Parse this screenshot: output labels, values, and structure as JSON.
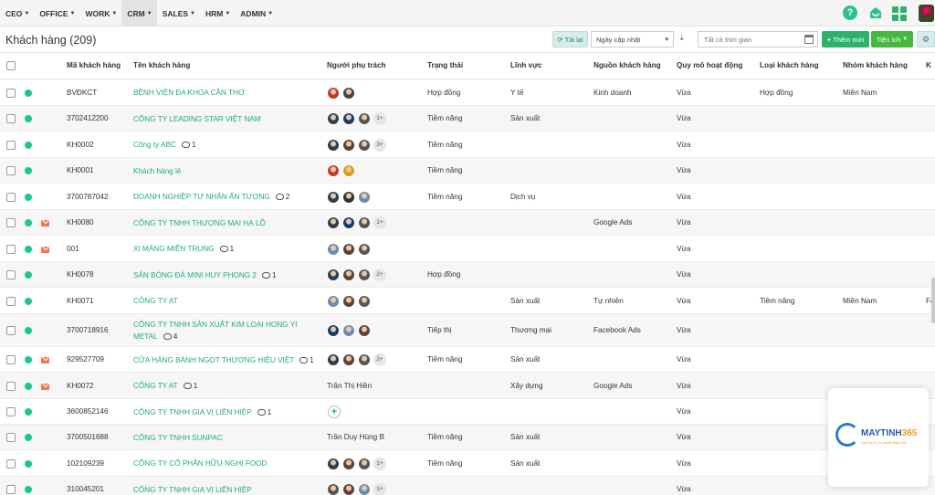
{
  "nav": {
    "menu": [
      {
        "label": "CEO",
        "active": false
      },
      {
        "label": "OFFICE",
        "active": false
      },
      {
        "label": "WORK",
        "active": false
      },
      {
        "label": "CRM",
        "active": true
      },
      {
        "label": "SALES",
        "active": false
      },
      {
        "label": "HRM",
        "active": false
      },
      {
        "label": "ADMIN",
        "active": false
      }
    ],
    "help_glyph": "?"
  },
  "toolbar": {
    "title": "Khách hàng (209)",
    "reload_label": "Tải lại",
    "sort_value": "Ngày cập nhật",
    "date_placeholder": "Tất cả thời gian",
    "add_label": "Thêm mới",
    "util_label": "Tiện ích"
  },
  "table": {
    "columns": [
      "Mã khách hàng",
      "Tên khách hàng",
      "Người phụ trách",
      "Trạng thái",
      "Lĩnh vực",
      "Nguồn khách hàng",
      "Quy mô hoạt động",
      "Loại khách hàng",
      "Nhóm khách hàng",
      "K"
    ],
    "rows": [
      {
        "code": "BVĐKCT",
        "name": "BỆNH VIỆN ĐA KHOA CẦN THƠ",
        "name2": "",
        "comments": "",
        "mail": false,
        "avatars": [
          "#c0392b",
          "#444"
        ],
        "more": "",
        "owner_text": "",
        "add": false,
        "status": "Hợp đồng",
        "field": "Y tế",
        "source": "Kinh doanh",
        "scale": "Vừa",
        "type": "Hợp đồng",
        "group": "Miền Nam",
        "extra": ""
      },
      {
        "code": "3702412200",
        "name": "CÔNG TY LEADING STAR VIỆT NAM",
        "name2": "",
        "comments": "",
        "mail": false,
        "avatars": [
          "#2c3e50",
          "#1a3a6b",
          "#555"
        ],
        "more": "1+",
        "owner_text": "",
        "add": false,
        "status": "Tiềm năng",
        "field": "Sản xuất",
        "source": "",
        "scale": "Vừa",
        "type": "",
        "group": "",
        "extra": ""
      },
      {
        "code": "KH0002",
        "name": "Công ty ABC",
        "name2": "",
        "comments": "1",
        "mail": false,
        "avatars": [
          "#2c3e50",
          "#5d4037",
          "#555"
        ],
        "more": "3+",
        "owner_text": "",
        "add": false,
        "status": "Tiềm năng",
        "field": "",
        "source": "",
        "scale": "Vừa",
        "type": "",
        "group": "",
        "extra": ""
      },
      {
        "code": "KH0001",
        "name": "Khách hàng lẻ",
        "name2": "",
        "comments": "",
        "mail": false,
        "avatars": [
          "#c0392b",
          "#d4a017"
        ],
        "more": "",
        "owner_text": "",
        "add": false,
        "status": "Tiềm năng",
        "field": "",
        "source": "",
        "scale": "Vừa",
        "type": "",
        "group": "",
        "extra": ""
      },
      {
        "code": "3700787042",
        "name": "DOANH NGHIỆP TƯ NHÂN ẤN TƯỢNG",
        "name2": "",
        "comments": "2",
        "mail": false,
        "avatars": [
          "#2c3e50",
          "#333",
          "#6d8ab0"
        ],
        "more": "",
        "owner_text": "",
        "add": false,
        "status": "Tiềm năng",
        "field": "Dịch vụ",
        "source": "",
        "scale": "Vừa",
        "type": "",
        "group": "",
        "extra": ""
      },
      {
        "code": "KH0080",
        "name": "CÔNG TY TNHH THƯƠNG MẠI HẠ LỘ",
        "name2": "",
        "comments": "",
        "mail": true,
        "avatars": [
          "#2c3e50",
          "#1a3a6b",
          "#555"
        ],
        "more": "1+",
        "owner_text": "",
        "add": false,
        "status": "",
        "field": "",
        "source": "Google Ads",
        "scale": "Vừa",
        "type": "",
        "group": "",
        "extra": ""
      },
      {
        "code": "001",
        "name": "XI MĂNG MIỀN TRUNG",
        "name2": "",
        "comments": "1",
        "mail": true,
        "avatars": [
          "#6d8ab0",
          "#5d4037",
          "#555"
        ],
        "more": "",
        "owner_text": "",
        "add": false,
        "status": "",
        "field": "",
        "source": "",
        "scale": "Vừa",
        "type": "",
        "group": "",
        "extra": ""
      },
      {
        "code": "KH0078",
        "name": "SÂN BÓNG ĐÁ MINI HUY PHONG 2",
        "name2": "",
        "comments": "1",
        "mail": false,
        "avatars": [
          "#2c3e50",
          "#5d4037",
          "#555"
        ],
        "more": "2+",
        "owner_text": "",
        "add": false,
        "status": "Hợp đồng",
        "field": "",
        "source": "",
        "scale": "Vừa",
        "type": "",
        "group": "",
        "extra": ""
      },
      {
        "code": "KH0071",
        "name": "CÔNG TY AT",
        "name2": "",
        "comments": "",
        "mail": false,
        "avatars": [
          "#6d8ab0",
          "#5d4037",
          "#555"
        ],
        "more": "",
        "owner_text": "",
        "add": false,
        "status": "",
        "field": "Sản xuất",
        "source": "Tự nhiên",
        "scale": "Vừa",
        "type": "Tiềm năng",
        "group": "Miền Nam",
        "extra": "Fa"
      },
      {
        "code": "3700718916",
        "name": "CÔNG TY TNHH SẢN XUẤT KIM LOẠI HONG YI",
        "name2": "METAL",
        "comments": "4",
        "mail": false,
        "avatars": [
          "#1a3a6b",
          "#6d8ab0",
          "#5d4037"
        ],
        "more": "",
        "owner_text": "",
        "add": false,
        "status": "Tiếp thị",
        "field": "Thương mại",
        "source": "Facebook Ads",
        "scale": "Vừa",
        "type": "",
        "group": "",
        "extra": ""
      },
      {
        "code": "929527709",
        "name": "CỬA HÀNG BÁNH NGỌT THƯƠNG HIỆU VIỆT",
        "name2": "",
        "comments": "1",
        "mail": true,
        "avatars": [
          "#2c3e50",
          "#5d4037",
          "#555"
        ],
        "more": "2+",
        "owner_text": "",
        "add": false,
        "status": "Tiềm năng",
        "field": "Sản xuất",
        "source": "",
        "scale": "Vừa",
        "type": "",
        "group": "",
        "extra": ""
      },
      {
        "code": "KH0072",
        "name": "CÔNG TY AT",
        "name2": "",
        "comments": "1",
        "mail": true,
        "avatars": [],
        "more": "",
        "owner_text": "Trần Thị Hiền",
        "add": false,
        "status": "",
        "field": "Xây dựng",
        "source": "Google Ads",
        "scale": "Vừa",
        "type": "",
        "group": "",
        "extra": ""
      },
      {
        "code": "3600852146",
        "name": "CÔNG TY TNHH GIA VỊ LIÊN HIỆP",
        "name2": "",
        "comments": "1",
        "mail": false,
        "avatars": [],
        "more": "",
        "owner_text": "",
        "add": true,
        "status": "",
        "field": "",
        "source": "",
        "scale": "Vừa",
        "type": "",
        "group": "",
        "extra": ""
      },
      {
        "code": "3700501688",
        "name": "CÔNG TY TNHH SUNPAC",
        "name2": "",
        "comments": "",
        "mail": false,
        "avatars": [],
        "more": "",
        "owner_text": "Trần Duy Hùng B",
        "add": false,
        "status": "Tiềm năng",
        "field": "Sản xuất",
        "source": "",
        "scale": "Vừa",
        "type": "",
        "group": "",
        "extra": ""
      },
      {
        "code": "102109239",
        "name": "CÔNG TY CỔ PHẦN HỮU NGHỊ FOOD",
        "name2": "",
        "comments": "",
        "mail": false,
        "avatars": [
          "#2c3e50",
          "#5d4037",
          "#555"
        ],
        "more": "1+",
        "owner_text": "",
        "add": false,
        "status": "Tiềm năng",
        "field": "Sản xuất",
        "source": "",
        "scale": "Vừa",
        "type": "",
        "group": "",
        "extra": ""
      },
      {
        "code": "310045201",
        "name": "CÔNG TY TNHH GIA VỊ LIÊN HIỆP",
        "name2": "",
        "comments": "",
        "mail": false,
        "avatars": [
          "#555",
          "#5d4037",
          "#6d8ab0"
        ],
        "more": "1+",
        "owner_text": "",
        "add": false,
        "status": "",
        "field": "",
        "source": "",
        "scale": "Vừa",
        "type": "",
        "group": "",
        "extra": ""
      }
    ]
  },
  "promo": {
    "brand_a": "MAYTINH",
    "brand_b": "365",
    "tagline": "Chữ ký & Trụ thuật Máy tính"
  },
  "colors": {
    "accent": "#22a88a",
    "status_dot": "#1ec39a",
    "add_button": "#2bb36b",
    "mail": "#f0764a"
  },
  "icons": {
    "help": "help-icon",
    "mail": "mail-icon",
    "apps": "apps-icon",
    "calendar": "calendar-icon"
  }
}
